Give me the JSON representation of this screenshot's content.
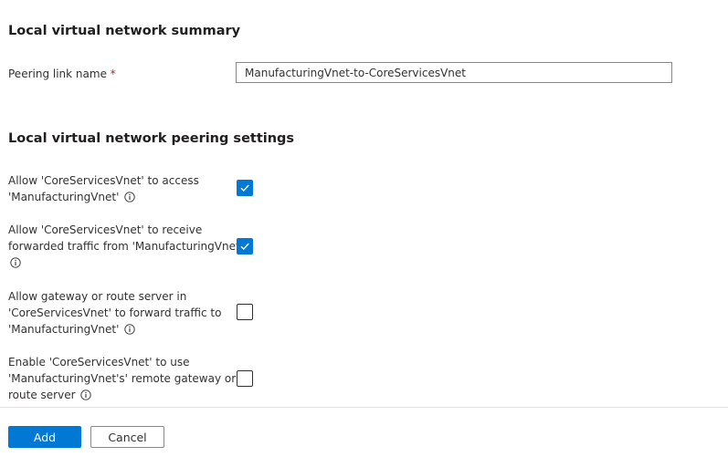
{
  "summary": {
    "title": "Local virtual network summary",
    "peering_link_label": "Peering link name",
    "required_mark": "*",
    "peering_link_value": "ManufacturingVnet-to-CoreServicesVnet"
  },
  "settings": {
    "title": "Local virtual network peering settings",
    "items": [
      {
        "label": "Allow 'CoreServicesVnet' to access 'ManufacturingVnet'",
        "checked": true,
        "info_icon": "info-icon"
      },
      {
        "label": "Allow 'CoreServicesVnet' to receive forwarded traffic from 'ManufacturingVnet'",
        "checked": true,
        "info_icon": "info-icon"
      },
      {
        "label": "Allow gateway or route server in 'CoreServicesVnet' to forward traffic to 'ManufacturingVnet'",
        "checked": false,
        "info_icon": "info-icon"
      },
      {
        "label": "Enable 'CoreServicesVnet' to use 'ManufacturingVnet's' remote gateway or route server",
        "checked": false,
        "info_icon": "info-icon"
      }
    ]
  },
  "footer": {
    "add_label": "Add",
    "cancel_label": "Cancel"
  },
  "colors": {
    "accent": "#0078d4",
    "required": "#a4262c",
    "text": "#323130"
  }
}
